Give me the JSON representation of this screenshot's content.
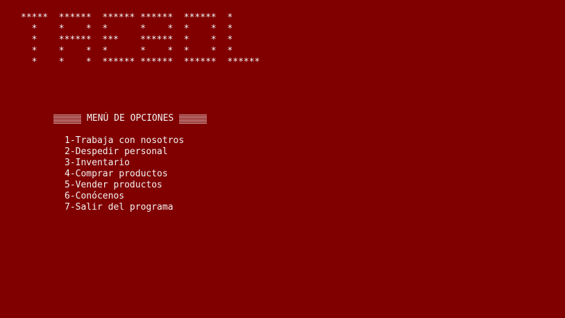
{
  "console": {
    "background_color": "#800000",
    "text_color": "#f2f2f2",
    "banner_art": "*****  ******  ****** ******  ******  *\n  *    *    *  *      *    *  *    *  *\n  *    ******  ***    ******  *    *  *\n  *    *    *  *      *    *  *    *  *\n  *    *    *  ****** ******  ******  ******",
    "menu": {
      "left_shade_icon": "shade-block-icon",
      "title": "MENÚ DE OPCIONES",
      "right_shade_icon": "shade-block-icon",
      "options": [
        "1-Trabaja con nosotros",
        "2-Despedir personal",
        "3-Inventario",
        "4-Comprar productos",
        "5-Vender productos",
        "6-Conócenos",
        "7-Salir del programa"
      ]
    }
  }
}
